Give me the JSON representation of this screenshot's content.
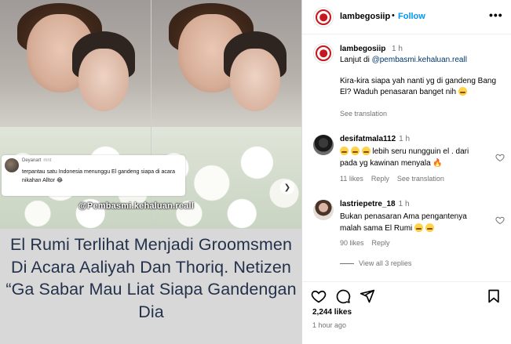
{
  "media": {
    "comment_card": {
      "name": "Deyanart",
      "time": "mnt",
      "text": "terpantau satu Indonesia menunggu El gandeng siapa di acara nikahan Alltor 😂"
    },
    "watermark": "@Pembasmi.kehaluan.reall",
    "headline": "El Rumi Terlihat Menjadi Groomsmen Di Acara Aaliyah Dan Thoriq. Netizen “Ga Sabar Mau Liat Siapa Gandengan Dia",
    "next_icon": "chevron-right-icon"
  },
  "header": {
    "username": "lambegosiip",
    "separator": "•",
    "follow_label": "Follow",
    "more_label": "•••"
  },
  "post": {
    "username": "lambegosiip",
    "time": "1 h",
    "line1_prefix": "Lanjut di ",
    "mention": "@pembasmi.kehaluan.reall",
    "body": "Kira-kira siapa yah nanti yg di gandeng Bang El? Waduh penasaran banget nih",
    "see_translation": "See translation"
  },
  "comments": [
    {
      "username": "desifatmala112",
      "time": "1 h",
      "text_after_emojis": "lebih seru nungguin el . dari pada yg kawinan menyala 🔥",
      "likes": "11 likes",
      "reply": "Reply",
      "see_translation": "See translation"
    },
    {
      "username": "lastriepetre_18",
      "time": "1 h",
      "text": "Bukan penasaran Ama pengantenya malah sama El Rumi",
      "likes": "90 likes",
      "reply": "Reply"
    }
  ],
  "view_replies": "View all 3 replies",
  "footer": {
    "likes": "2,244 likes",
    "time_ago": "1 hour ago"
  },
  "colors": {
    "follow": "#0095f6",
    "mention": "#00376b",
    "headline": "#24314a",
    "caption_bg": "#d8d8d8",
    "secondary_text": "#737373"
  }
}
